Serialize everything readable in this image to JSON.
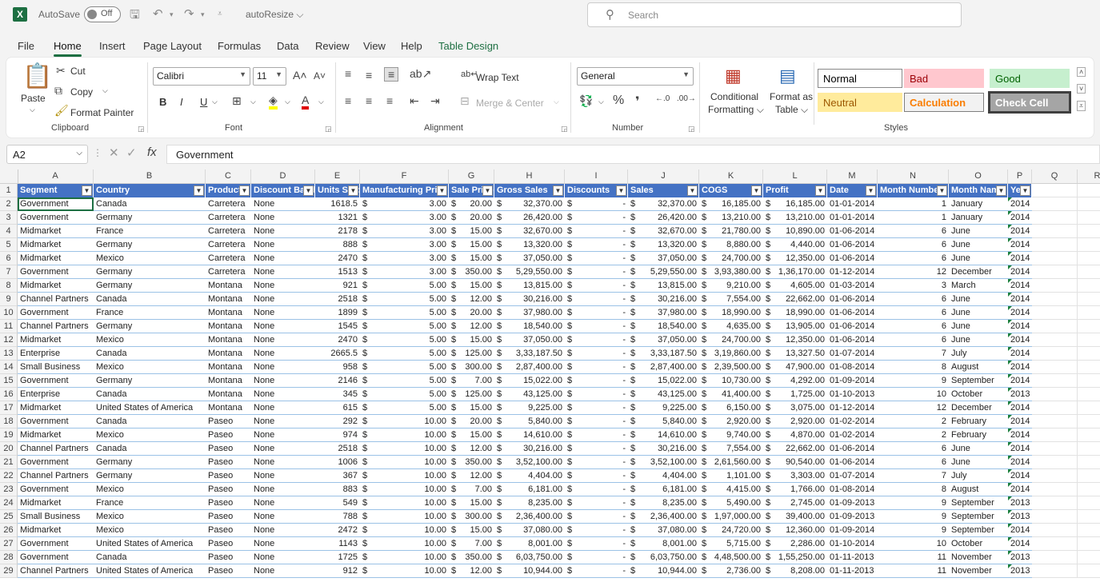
{
  "titlebar": {
    "app_icon": "X",
    "autosave_label": "AutoSave",
    "autosave_state": "Off",
    "doc_name": "autoResize",
    "search_placeholder": "Search"
  },
  "tabs": [
    "File",
    "Home",
    "Insert",
    "Page Layout",
    "Formulas",
    "Data",
    "Review",
    "View",
    "Help",
    "Table Design"
  ],
  "active_tab": "Home",
  "ribbon": {
    "clipboard": {
      "paste": "Paste",
      "cut": "Cut",
      "copy": "Copy",
      "format_painter": "Format Painter",
      "label": "Clipboard"
    },
    "font": {
      "name": "Calibri",
      "size": "11",
      "label": "Font",
      "bold": "B",
      "italic": "I",
      "underline": "U"
    },
    "alignment": {
      "wrap_text": "Wrap Text",
      "merge_center": "Merge & Center",
      "label": "Alignment"
    },
    "number": {
      "format": "General",
      "label": "Number"
    },
    "styles": {
      "conditional": "Conditional",
      "conditional2": "Formatting",
      "format_as": "Format as",
      "format_as2": "Table",
      "label": "Styles",
      "cells": [
        {
          "name": "Normal",
          "bg": "#ffffff",
          "fg": "#000000",
          "border": "#888888"
        },
        {
          "name": "Bad",
          "bg": "#ffc7ce",
          "fg": "#9c0006",
          "border": "#ffc7ce"
        },
        {
          "name": "Good",
          "bg": "#c6efce",
          "fg": "#006100",
          "border": "#c6efce"
        },
        {
          "name": "Neutral",
          "bg": "#ffeb9c",
          "fg": "#9c5700",
          "border": "#ffeb9c"
        },
        {
          "name": "Calculation",
          "bg": "#f2f2f2",
          "fg": "#fa7d00",
          "border": "#7f7f7f"
        },
        {
          "name": "Check Cell",
          "bg": "#a5a5a5",
          "fg": "#ffffff",
          "border": "#3f3f3f"
        }
      ]
    }
  },
  "formula_bar": {
    "name_box": "A2",
    "content": "Government"
  },
  "sheet": {
    "column_letters": [
      "A",
      "B",
      "C",
      "D",
      "E",
      "F",
      "G",
      "H",
      "I",
      "J",
      "K",
      "L",
      "M",
      "N",
      "O",
      "P",
      "Q",
      "R"
    ],
    "headers": [
      "Segment",
      "Country",
      "Product",
      "Discount Band",
      "Units Sold",
      "Manufacturing Price",
      "Sale Price",
      "Gross Sales",
      "Discounts",
      "Sales",
      "COGS",
      "Profit",
      "Date",
      "Month Number",
      "Month Name",
      "Year"
    ],
    "rows": [
      [
        "Government",
        "Canada",
        "Carretera",
        "None",
        "1618.5",
        "3.00",
        "20.00",
        "32,370.00",
        "-",
        "32,370.00",
        "16,185.00",
        "16,185.00",
        "01-01-2014",
        "1",
        "January",
        "2014"
      ],
      [
        "Government",
        "Germany",
        "Carretera",
        "None",
        "1321",
        "3.00",
        "20.00",
        "26,420.00",
        "-",
        "26,420.00",
        "13,210.00",
        "13,210.00",
        "01-01-2014",
        "1",
        "January",
        "2014"
      ],
      [
        "Midmarket",
        "France",
        "Carretera",
        "None",
        "2178",
        "3.00",
        "15.00",
        "32,670.00",
        "-",
        "32,670.00",
        "21,780.00",
        "10,890.00",
        "01-06-2014",
        "6",
        "June",
        "2014"
      ],
      [
        "Midmarket",
        "Germany",
        "Carretera",
        "None",
        "888",
        "3.00",
        "15.00",
        "13,320.00",
        "-",
        "13,320.00",
        "8,880.00",
        "4,440.00",
        "01-06-2014",
        "6",
        "June",
        "2014"
      ],
      [
        "Midmarket",
        "Mexico",
        "Carretera",
        "None",
        "2470",
        "3.00",
        "15.00",
        "37,050.00",
        "-",
        "37,050.00",
        "24,700.00",
        "12,350.00",
        "01-06-2014",
        "6",
        "June",
        "2014"
      ],
      [
        "Government",
        "Germany",
        "Carretera",
        "None",
        "1513",
        "3.00",
        "350.00",
        "5,29,550.00",
        "-",
        "5,29,550.00",
        "3,93,380.00",
        "1,36,170.00",
        "01-12-2014",
        "12",
        "December",
        "2014"
      ],
      [
        "Midmarket",
        "Germany",
        "Montana",
        "None",
        "921",
        "5.00",
        "15.00",
        "13,815.00",
        "-",
        "13,815.00",
        "9,210.00",
        "4,605.00",
        "01-03-2014",
        "3",
        "March",
        "2014"
      ],
      [
        "Channel Partners",
        "Canada",
        "Montana",
        "None",
        "2518",
        "5.00",
        "12.00",
        "30,216.00",
        "-",
        "30,216.00",
        "7,554.00",
        "22,662.00",
        "01-06-2014",
        "6",
        "June",
        "2014"
      ],
      [
        "Government",
        "France",
        "Montana",
        "None",
        "1899",
        "5.00",
        "20.00",
        "37,980.00",
        "-",
        "37,980.00",
        "18,990.00",
        "18,990.00",
        "01-06-2014",
        "6",
        "June",
        "2014"
      ],
      [
        "Channel Partners",
        "Germany",
        "Montana",
        "None",
        "1545",
        "5.00",
        "12.00",
        "18,540.00",
        "-",
        "18,540.00",
        "4,635.00",
        "13,905.00",
        "01-06-2014",
        "6",
        "June",
        "2014"
      ],
      [
        "Midmarket",
        "Mexico",
        "Montana",
        "None",
        "2470",
        "5.00",
        "15.00",
        "37,050.00",
        "-",
        "37,050.00",
        "24,700.00",
        "12,350.00",
        "01-06-2014",
        "6",
        "June",
        "2014"
      ],
      [
        "Enterprise",
        "Canada",
        "Montana",
        "None",
        "2665.5",
        "5.00",
        "125.00",
        "3,33,187.50",
        "-",
        "3,33,187.50",
        "3,19,860.00",
        "13,327.50",
        "01-07-2014",
        "7",
        "July",
        "2014"
      ],
      [
        "Small Business",
        "Mexico",
        "Montana",
        "None",
        "958",
        "5.00",
        "300.00",
        "2,87,400.00",
        "-",
        "2,87,400.00",
        "2,39,500.00",
        "47,900.00",
        "01-08-2014",
        "8",
        "August",
        "2014"
      ],
      [
        "Government",
        "Germany",
        "Montana",
        "None",
        "2146",
        "5.00",
        "7.00",
        "15,022.00",
        "-",
        "15,022.00",
        "10,730.00",
        "4,292.00",
        "01-09-2014",
        "9",
        "September",
        "2014"
      ],
      [
        "Enterprise",
        "Canada",
        "Montana",
        "None",
        "345",
        "5.00",
        "125.00",
        "43,125.00",
        "-",
        "43,125.00",
        "41,400.00",
        "1,725.00",
        "01-10-2013",
        "10",
        "October",
        "2013"
      ],
      [
        "Midmarket",
        "United States of America",
        "Montana",
        "None",
        "615",
        "5.00",
        "15.00",
        "9,225.00",
        "-",
        "9,225.00",
        "6,150.00",
        "3,075.00",
        "01-12-2014",
        "12",
        "December",
        "2014"
      ],
      [
        "Government",
        "Canada",
        "Paseo",
        "None",
        "292",
        "10.00",
        "20.00",
        "5,840.00",
        "-",
        "5,840.00",
        "2,920.00",
        "2,920.00",
        "01-02-2014",
        "2",
        "February",
        "2014"
      ],
      [
        "Midmarket",
        "Mexico",
        "Paseo",
        "None",
        "974",
        "10.00",
        "15.00",
        "14,610.00",
        "-",
        "14,610.00",
        "9,740.00",
        "4,870.00",
        "01-02-2014",
        "2",
        "February",
        "2014"
      ],
      [
        "Channel Partners",
        "Canada",
        "Paseo",
        "None",
        "2518",
        "10.00",
        "12.00",
        "30,216.00",
        "-",
        "30,216.00",
        "7,554.00",
        "22,662.00",
        "01-06-2014",
        "6",
        "June",
        "2014"
      ],
      [
        "Government",
        "Germany",
        "Paseo",
        "None",
        "1006",
        "10.00",
        "350.00",
        "3,52,100.00",
        "-",
        "3,52,100.00",
        "2,61,560.00",
        "90,540.00",
        "01-06-2014",
        "6",
        "June",
        "2014"
      ],
      [
        "Channel Partners",
        "Germany",
        "Paseo",
        "None",
        "367",
        "10.00",
        "12.00",
        "4,404.00",
        "-",
        "4,404.00",
        "1,101.00",
        "3,303.00",
        "01-07-2014",
        "7",
        "July",
        "2014"
      ],
      [
        "Government",
        "Mexico",
        "Paseo",
        "None",
        "883",
        "10.00",
        "7.00",
        "6,181.00",
        "-",
        "6,181.00",
        "4,415.00",
        "1,766.00",
        "01-08-2014",
        "8",
        "August",
        "2014"
      ],
      [
        "Midmarket",
        "France",
        "Paseo",
        "None",
        "549",
        "10.00",
        "15.00",
        "8,235.00",
        "-",
        "8,235.00",
        "5,490.00",
        "2,745.00",
        "01-09-2013",
        "9",
        "September",
        "2013"
      ],
      [
        "Small Business",
        "Mexico",
        "Paseo",
        "None",
        "788",
        "10.00",
        "300.00",
        "2,36,400.00",
        "-",
        "2,36,400.00",
        "1,97,000.00",
        "39,400.00",
        "01-09-2013",
        "9",
        "September",
        "2013"
      ],
      [
        "Midmarket",
        "Mexico",
        "Paseo",
        "None",
        "2472",
        "10.00",
        "15.00",
        "37,080.00",
        "-",
        "37,080.00",
        "24,720.00",
        "12,360.00",
        "01-09-2014",
        "9",
        "September",
        "2014"
      ],
      [
        "Government",
        "United States of America",
        "Paseo",
        "None",
        "1143",
        "10.00",
        "7.00",
        "8,001.00",
        "-",
        "8,001.00",
        "5,715.00",
        "2,286.00",
        "01-10-2014",
        "10",
        "October",
        "2014"
      ],
      [
        "Government",
        "Canada",
        "Paseo",
        "None",
        "1725",
        "10.00",
        "350.00",
        "6,03,750.00",
        "-",
        "6,03,750.00",
        "4,48,500.00",
        "1,55,250.00",
        "01-11-2013",
        "11",
        "November",
        "2013"
      ],
      [
        "Channel Partners",
        "United States of America",
        "Paseo",
        "None",
        "912",
        "10.00",
        "12.00",
        "10,944.00",
        "-",
        "10,944.00",
        "2,736.00",
        "8,208.00",
        "01-11-2013",
        "11",
        "November",
        "2013"
      ]
    ]
  }
}
